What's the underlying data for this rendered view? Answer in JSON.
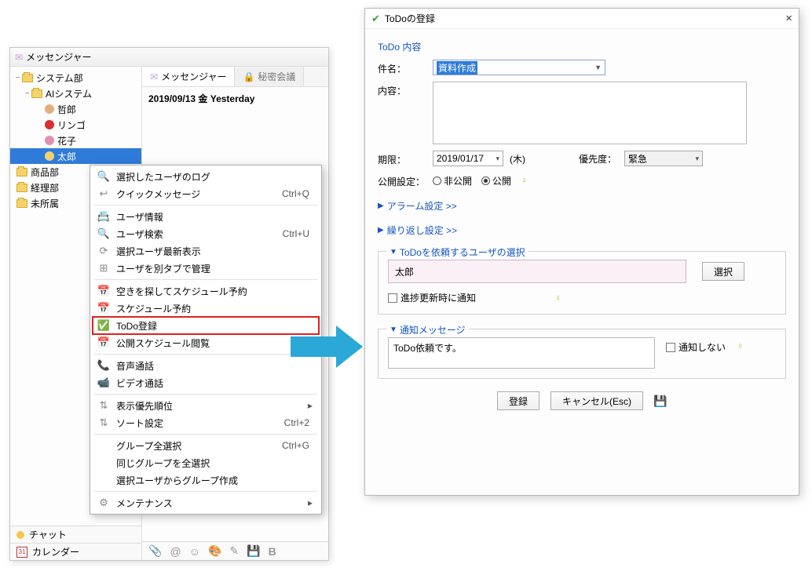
{
  "left_window": {
    "title": "メッセンジャー",
    "tree": {
      "root": "システム部",
      "ai_group": "AIシステム",
      "users": [
        "哲郎",
        "リンゴ",
        "花子",
        "太郎"
      ],
      "other_groups": [
        "商品部",
        "経理部",
        "未所属"
      ]
    },
    "tabs": {
      "messenger": "メッセンジャー",
      "secret": "秘密会議"
    },
    "date_header": "2019/09/13 金 Yesterday",
    "bottom": {
      "chat": "チャット",
      "calendar": "カレンダー",
      "cal_num": "31"
    }
  },
  "context_menu": {
    "items": [
      {
        "icon": "search",
        "label": "選択したユーザのログ",
        "shortcut": "",
        "sub": false
      },
      {
        "icon": "reply",
        "label": "クイックメッセージ",
        "shortcut": "Ctrl+Q",
        "sub": false,
        "sep_after": true
      },
      {
        "icon": "card",
        "label": "ユーザ情報",
        "shortcut": "",
        "sub": false
      },
      {
        "icon": "search",
        "label": "ユーザ検索",
        "shortcut": "Ctrl+U",
        "sub": false
      },
      {
        "icon": "refresh",
        "label": "選択ユーザ最新表示",
        "shortcut": "",
        "sub": false
      },
      {
        "icon": "tab",
        "label": "ユーザを別タブで管理",
        "shortcut": "",
        "sub": false,
        "sep_after": true
      },
      {
        "icon": "sched",
        "label": "空きを探してスケジュール予約",
        "shortcut": "",
        "sub": false
      },
      {
        "icon": "sched",
        "label": "スケジュール予約",
        "shortcut": "",
        "sub": false
      },
      {
        "icon": "check",
        "label": "ToDo登録",
        "shortcut": "",
        "sub": false,
        "highlight": true
      },
      {
        "icon": "sched",
        "label": "公開スケジュール閲覧",
        "shortcut": "",
        "sub": false,
        "sep_after": true
      },
      {
        "icon": "phone",
        "label": "音声通話",
        "shortcut": "",
        "sub": false
      },
      {
        "icon": "video",
        "label": "ビデオ通話",
        "shortcut": "",
        "sub": false,
        "sep_after": true
      },
      {
        "icon": "sort",
        "label": "表示優先順位",
        "shortcut": "",
        "sub": true
      },
      {
        "icon": "sort",
        "label": "ソート設定",
        "shortcut": "Ctrl+2",
        "sub": false,
        "sep_after": true
      },
      {
        "icon": "",
        "label": "グループ全選択",
        "shortcut": "Ctrl+G",
        "sub": false
      },
      {
        "icon": "",
        "label": "同じグループを全選択",
        "shortcut": "",
        "sub": false
      },
      {
        "icon": "",
        "label": "選択ユーザからグループ作成",
        "shortcut": "",
        "sub": false,
        "sep_after": true
      },
      {
        "icon": "gear",
        "label": "メンテナンス",
        "shortcut": "",
        "sub": true
      }
    ]
  },
  "dialog": {
    "title": "ToDoの登録",
    "section_content": "ToDo 内容",
    "subject_label": "件名：",
    "subject_value": "資料作成",
    "body_label": "内容：",
    "deadline_label": "期限：",
    "deadline_value": "2019/01/17",
    "weekday": "(木)",
    "priority_label": "優先度：",
    "priority_value": "緊急",
    "visibility_label": "公開設定：",
    "visibility_private": "非公開",
    "visibility_public": "公開",
    "alarm_section": "アラーム設定 >>",
    "repeat_section": "繰り返し設定 >>",
    "assign_section": "ToDoを依頼するユーザの選択",
    "assign_user": "太郎",
    "select_btn": "選択",
    "notify_progress": "進捗更新時に通知",
    "notify_section": "通知メッセージ",
    "notify_msg": "ToDo依頼です。",
    "no_notify": "通知しない",
    "register_btn": "登録",
    "cancel_btn": "キャンセル(Esc)"
  }
}
